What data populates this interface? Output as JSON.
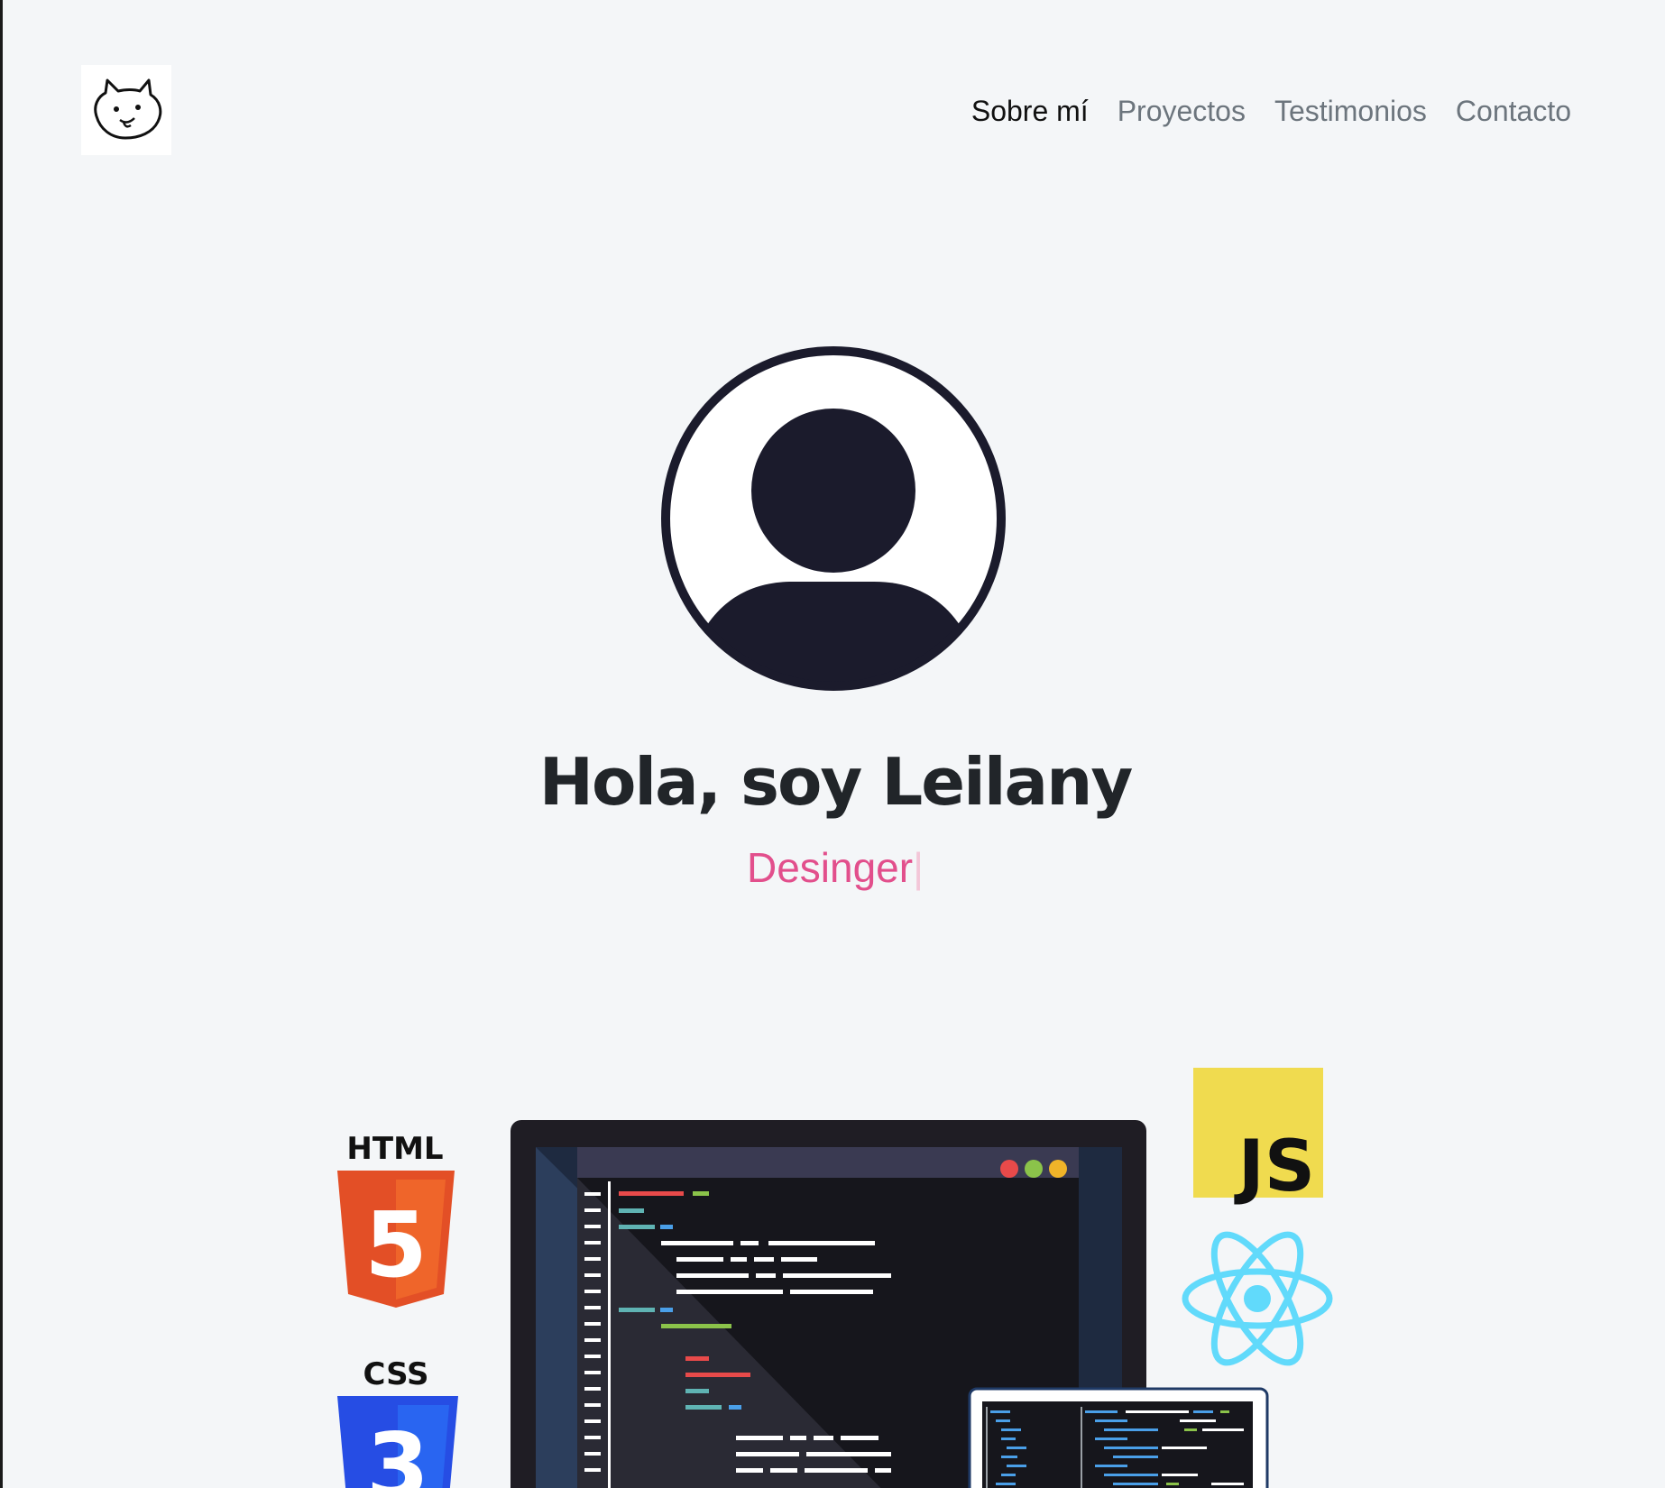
{
  "nav": {
    "items": [
      {
        "label": "Sobre mí",
        "active": true
      },
      {
        "label": "Proyectos",
        "active": false
      },
      {
        "label": "Testimonios",
        "active": false
      },
      {
        "label": "Contacto",
        "active": false
      }
    ]
  },
  "hero": {
    "title": "Hola, soy Leilany",
    "subtitle": "Desinger",
    "cursor": "|",
    "subtitle_color": "#e24f8c"
  },
  "tech_icons": {
    "html_label": "HTML",
    "html_number": "5",
    "css_label": "CSS",
    "css_number": "3",
    "js_label": "JS"
  },
  "colors": {
    "background": "#f4f6f8",
    "avatar_dark": "#1b1b2c",
    "html": "#e34f26",
    "css": "#264de4",
    "js": "#f0db4f",
    "react": "#61dafb"
  }
}
